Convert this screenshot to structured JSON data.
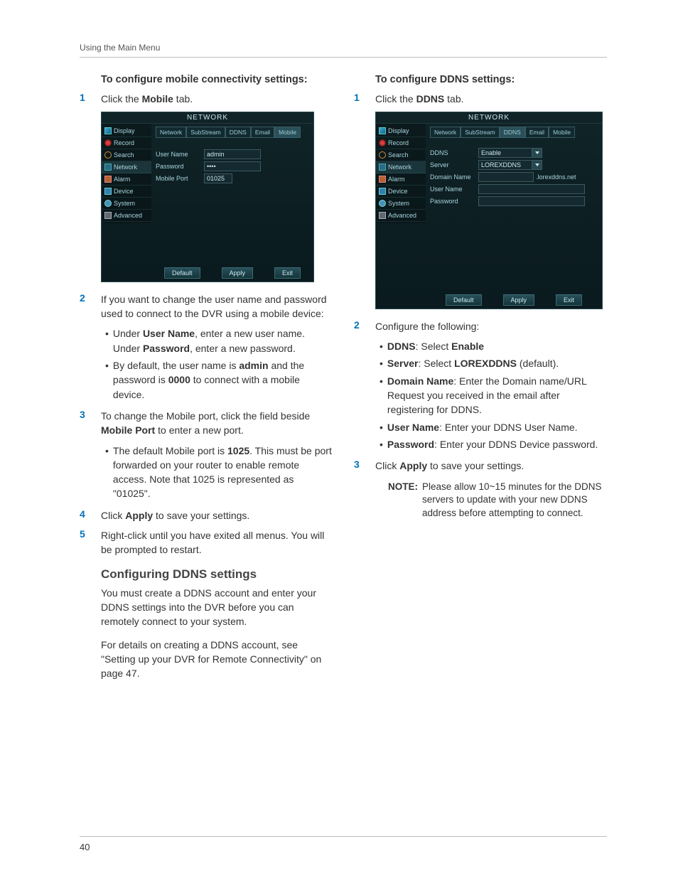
{
  "header": "Using the Main Menu",
  "page_number": "40",
  "left": {
    "heading": "To configure mobile connectivity settings:",
    "steps": {
      "1": {
        "text_a": "Click the ",
        "bold": "Mobile",
        "text_b": " tab."
      },
      "2": "If you want to change the user name and password used to connect to the DVR using a mobile device:",
      "3": {
        "text_a": "To change the Mobile port, click the field beside ",
        "bold": "Mobile Port",
        "text_b": " to enter a new port."
      },
      "4": {
        "text_a": "Click ",
        "bold": "Apply",
        "text_b": " to save your settings."
      },
      "5": "Right-click until you have exited all menus. You will be prompted to restart."
    },
    "bullets2": {
      "a": {
        "t1": "Under ",
        "b1": "User Name",
        "t2": ", enter a new user name. Under ",
        "b2": "Password",
        "t3": ", enter a new password."
      },
      "b": {
        "t1": "By default, the user name is ",
        "b1": "admin",
        "t2": " and the password is ",
        "b2": "0000",
        "t3": " to connect with a mobile device."
      }
    },
    "bullets3": {
      "a": {
        "t1": "The default Mobile port is ",
        "b1": "1025",
        "t2": ". This must be port forwarded on your router to enable remote access. Note that 1025 is represented as \"01025\"."
      }
    },
    "subhead": "Configuring DDNS settings",
    "para1": "You must create a DDNS account and enter your DDNS settings into the DVR before you can remotely connect to your system.",
    "para2": "For details on creating a DDNS account, see \"Setting up your DVR for Remote Connectivity\" on page 47."
  },
  "right": {
    "heading": "To configure DDNS settings:",
    "steps": {
      "1": {
        "text_a": "Click the ",
        "bold": "DDNS",
        "text_b": " tab."
      },
      "2": "Configure the following:",
      "3": {
        "text_a": "Click ",
        "bold": "Apply",
        "text_b": " to save your settings."
      }
    },
    "bullets2": {
      "a": {
        "b1": "DDNS",
        "t1": ": Select ",
        "b2": "Enable"
      },
      "b": {
        "b1": "Server",
        "t1": ": Select ",
        "b2": "LOREXDDNS",
        "t2": " (default)."
      },
      "c": {
        "b1": "Domain Name",
        "t1": ": Enter the Domain name/URL Request you received in the email after registering for DDNS."
      },
      "d": {
        "b1": "User Name",
        "t1": ": Enter your DDNS User Name."
      },
      "e": {
        "b1": "Password",
        "t1": ": Enter your DDNS Device password."
      }
    },
    "note_label": "NOTE:",
    "note_body": "Please allow 10~15 minutes for the DDNS servers to update with your new DDNS address before attempting to connect."
  },
  "dvr": {
    "title": "NETWORK",
    "sidebar": [
      "Display",
      "Record",
      "Search",
      "Network",
      "Alarm",
      "Device",
      "System",
      "Advanced"
    ],
    "tabs": [
      "Network",
      "SubStream",
      "DDNS",
      "Email",
      "Mobile"
    ],
    "buttons": [
      "Default",
      "Apply",
      "Exit"
    ],
    "mobile": {
      "user_label": "User Name",
      "user_val": "admin",
      "pwd_label": "Password",
      "pwd_val": "••••",
      "port_label": "Mobile Port",
      "port_val": "01025"
    },
    "ddns": {
      "ddns_label": "DDNS",
      "ddns_val": "Enable",
      "server_label": "Server",
      "server_val": "LOREXDDNS",
      "domain_label": "Domain Name",
      "domain_suffix": ".lorexddns.net",
      "user_label": "User Name",
      "pwd_label": "Password"
    }
  }
}
